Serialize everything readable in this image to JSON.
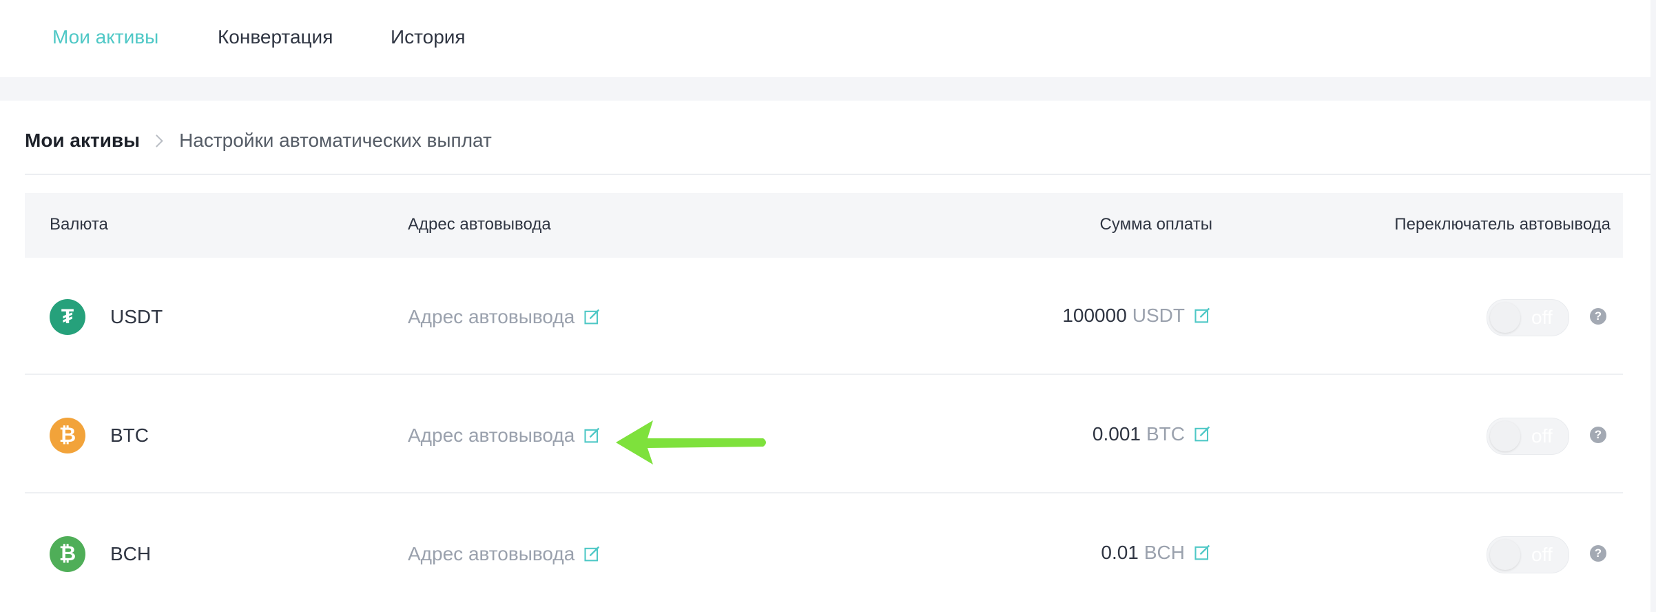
{
  "nav": {
    "tabs": [
      {
        "label": "Мои активы"
      },
      {
        "label": "Конвертация"
      },
      {
        "label": "История"
      }
    ]
  },
  "breadcrumb": {
    "root": "Мои активы",
    "current": "Настройки автоматических выплат"
  },
  "table": {
    "headers": {
      "currency": "Валюта",
      "address": "Адрес автовывода",
      "amount": "Сумма оплаты",
      "switch": "Переключатель автовывода"
    },
    "rows": [
      {
        "coin": "USDT",
        "icon": "tether-icon",
        "icon_glyph": "₮",
        "icon_color": "#26a17b",
        "address_placeholder": "Адрес автовывода",
        "amount": "100000",
        "unit": "USDT",
        "toggle": "off"
      },
      {
        "coin": "BTC",
        "icon": "bitcoin-icon",
        "icon_glyph": "₿",
        "icon_color": "#f2a33a",
        "address_placeholder": "Адрес автовывода",
        "amount": "0.001",
        "unit": "BTC",
        "toggle": "off"
      },
      {
        "coin": "BCH",
        "icon": "bitcoin-cash-icon",
        "icon_glyph": "₿",
        "icon_color": "#4fae58",
        "address_placeholder": "Адрес автовывода",
        "amount": "0.01",
        "unit": "BCH",
        "toggle": "off"
      }
    ]
  },
  "help_glyph": "?",
  "colors": {
    "accent": "#4fc8c6",
    "annotation_arrow": "#7ee13c"
  }
}
